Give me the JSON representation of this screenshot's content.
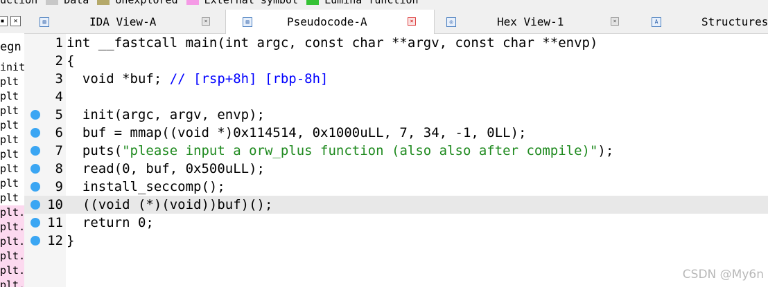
{
  "legend": [
    {
      "label": "uction",
      "color": ""
    },
    {
      "label": "Data",
      "color": "#c8c8c8"
    },
    {
      "label": "Unexplored",
      "color": "#b5a96a"
    },
    {
      "label": "External symbol",
      "color": "#f59ae6"
    },
    {
      "label": "Lumina function",
      "color": "#35c235"
    }
  ],
  "left_panel": {
    "title": "egn",
    "rows": [
      {
        "text": "init",
        "pink": false
      },
      {
        "text": "plt",
        "pink": false
      },
      {
        "text": "plt",
        "pink": false
      },
      {
        "text": "plt",
        "pink": false
      },
      {
        "text": "plt",
        "pink": false
      },
      {
        "text": "plt",
        "pink": false
      },
      {
        "text": "plt",
        "pink": false
      },
      {
        "text": "plt",
        "pink": false
      },
      {
        "text": "plt",
        "pink": false
      },
      {
        "text": "plt",
        "pink": false
      },
      {
        "text": "plt.",
        "pink": true
      },
      {
        "text": "plt.",
        "pink": true
      },
      {
        "text": "plt.",
        "pink": true
      },
      {
        "text": "plt.",
        "pink": true
      },
      {
        "text": "plt.",
        "pink": true
      },
      {
        "text": "plt.",
        "pink": true
      }
    ]
  },
  "tabs": [
    {
      "label": "IDA View-A",
      "icon": "ida-view-icon",
      "close": "×"
    },
    {
      "label": "Pseudocode-A",
      "icon": "pseudocode-icon",
      "close": "×"
    },
    {
      "label": "Hex View-1",
      "icon": "hex-view-icon",
      "close": "×"
    },
    {
      "label": "Structures",
      "icon": "structures-icon",
      "close": ""
    }
  ],
  "code": {
    "lines": [
      {
        "num": "1",
        "text": "int __fastcall main(int argc, const char **argv, const char **envp)",
        "dot": false
      },
      {
        "num": "2",
        "text": "{",
        "dot": false
      },
      {
        "num": "3",
        "text": "  void *buf; // [rsp+8h] [rbp-8h]",
        "dot": false
      },
      {
        "num": "4",
        "text": "",
        "dot": false
      },
      {
        "num": "5",
        "text": "  init(argc, argv, envp);",
        "dot": true
      },
      {
        "num": "6",
        "text": "  buf = mmap((void *)0x114514, 0x1000uLL, 7, 34, -1, 0LL);",
        "dot": true
      },
      {
        "num": "7",
        "text": "  puts(\"please input a orw_plus function (also also after compile)\");",
        "dot": true
      },
      {
        "num": "8",
        "text": "  read(0, buf, 0x500uLL);",
        "dot": true
      },
      {
        "num": "9",
        "text": "  install_seccomp();",
        "dot": true
      },
      {
        "num": "10",
        "text": "  ((void (*)(void))buf)();",
        "dot": true
      },
      {
        "num": "11",
        "text": "  return 0;",
        "dot": true
      },
      {
        "num": "12",
        "text": "}",
        "dot": true
      }
    ],
    "highlighted_line": "10"
  },
  "watermark": "CSDN @My6n"
}
